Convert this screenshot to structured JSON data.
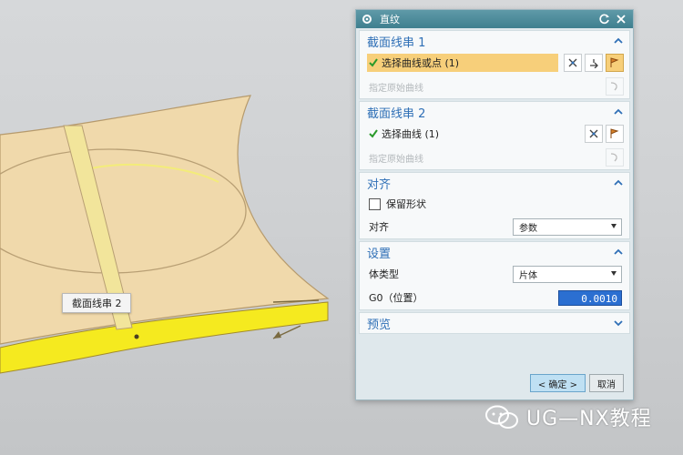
{
  "viewport": {
    "label": "截面线串 2"
  },
  "dialog": {
    "title": "直纹",
    "sections": {
      "s1": {
        "title": "截面线串 1",
        "select_row": "选择曲线或点 (1)",
        "start_row": "指定原始曲线"
      },
      "s2": {
        "title": "截面线串 2",
        "select_row": "选择曲线 (1)",
        "start_row": "指定原始曲线"
      },
      "align": {
        "title": "对齐",
        "preserve_shape": "保留形状",
        "align_label": "对齐",
        "align_value": "参数"
      },
      "settings": {
        "title": "设置",
        "body_type_label": "体类型",
        "body_type_value": "片体",
        "g0_label": "G0（位置）",
        "g0_value": "0.0010"
      },
      "preview": {
        "title": "预览"
      }
    },
    "buttons": {
      "ok": "< 确定 >",
      "cancel": "取消"
    }
  },
  "watermark": {
    "text": "UG—NX教程"
  },
  "colors": {
    "accent": "#2e6fb6",
    "selection": "#f7cf7a",
    "surface": "#f0d9ab",
    "edge": "#f7ec2a"
  }
}
